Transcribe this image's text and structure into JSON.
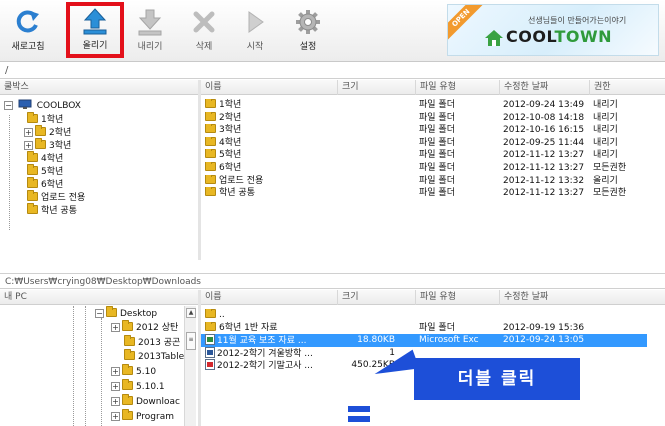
{
  "toolbar": {
    "buttons": [
      {
        "id": "refresh",
        "label": "새로고침",
        "icon": "refresh-icon"
      },
      {
        "id": "upload",
        "label": "올리기",
        "icon": "upload-icon",
        "selected": true
      },
      {
        "id": "download",
        "label": "내리기",
        "icon": "download-icon"
      },
      {
        "id": "delete",
        "label": "삭제",
        "icon": "delete-icon"
      },
      {
        "id": "start",
        "label": "시작",
        "icon": "play-icon"
      },
      {
        "id": "settings",
        "label": "설정",
        "icon": "gear-icon"
      }
    ],
    "banner": {
      "ribbon": "OPEN",
      "subtitle": "선생님들이 만들어가는이야기",
      "logo_pre": "COOL",
      "logo_post": "TOWN"
    }
  },
  "remote_path": "/",
  "top_tree": {
    "header": "쿨박스",
    "root": "COOLBOX",
    "items": [
      "1학년",
      "2학년",
      "3학년",
      "4학년",
      "5학년",
      "6학년",
      "업로드 전용",
      "학년 공통"
    ]
  },
  "top_list": {
    "columns": [
      "이름",
      "크기",
      "파일 유형",
      "수정한 날짜",
      "권한"
    ],
    "rows": [
      {
        "name": "1학년",
        "size": "",
        "type": "파일 폴더",
        "date": "2012-09-24 13:49",
        "perm": "내리기"
      },
      {
        "name": "2학년",
        "size": "",
        "type": "파일 폴더",
        "date": "2012-10-08 14:18",
        "perm": "내리기"
      },
      {
        "name": "3학년",
        "size": "",
        "type": "파일 폴더",
        "date": "2012-10-16 16:15",
        "perm": "내리기"
      },
      {
        "name": "4학년",
        "size": "",
        "type": "파일 폴더",
        "date": "2012-09-25 11:44",
        "perm": "내리기"
      },
      {
        "name": "5학년",
        "size": "",
        "type": "파일 폴더",
        "date": "2012-11-12 13:27",
        "perm": "내리기"
      },
      {
        "name": "6학년",
        "size": "",
        "type": "파일 폴더",
        "date": "2012-11-12 13:27",
        "perm": "모든권한"
      },
      {
        "name": "업로드 전용",
        "size": "",
        "type": "파일 폴더",
        "date": "2012-11-12 13:32",
        "perm": "올리기"
      },
      {
        "name": "학년 공통",
        "size": "",
        "type": "파일 폴더",
        "date": "2012-11-12 13:27",
        "perm": "모든권한"
      }
    ]
  },
  "local_path": "C:₩Users₩crying08₩Desktop₩Downloads",
  "bottom_tree": {
    "header": "내 PC",
    "items": [
      "Desktop",
      "2012 상탄",
      "2013 공곤",
      "2013Table",
      "5.10",
      "5.10.1",
      "Downloac",
      "Program"
    ]
  },
  "bottom_list": {
    "columns": [
      "이름",
      "크기",
      "파일 유형",
      "수정한 날짜"
    ],
    "rows": [
      {
        "name": "..",
        "size": "",
        "type": "",
        "date": "",
        "icon": "folder"
      },
      {
        "name": "6학년 1반 자료",
        "size": "",
        "type": "파일 폴더",
        "date": "2012-09-19 15:36",
        "icon": "folder"
      },
      {
        "name": "11월 교육 보조 자료 ...",
        "size": "18.80KB",
        "type": "Microsoft Exc",
        "date": "2012-09-24 13:05",
        "icon": "xls",
        "selected": true
      },
      {
        "name": "2012-2학기 겨울방학 ...",
        "size": "1",
        "type": "",
        "date": "",
        "icon": "doc"
      },
      {
        "name": "2012-2학기 기말고사 ...",
        "size": "450.25KB",
        "type": "",
        "date": "",
        "icon": "pdf"
      }
    ]
  },
  "callout": "더블 클릭"
}
